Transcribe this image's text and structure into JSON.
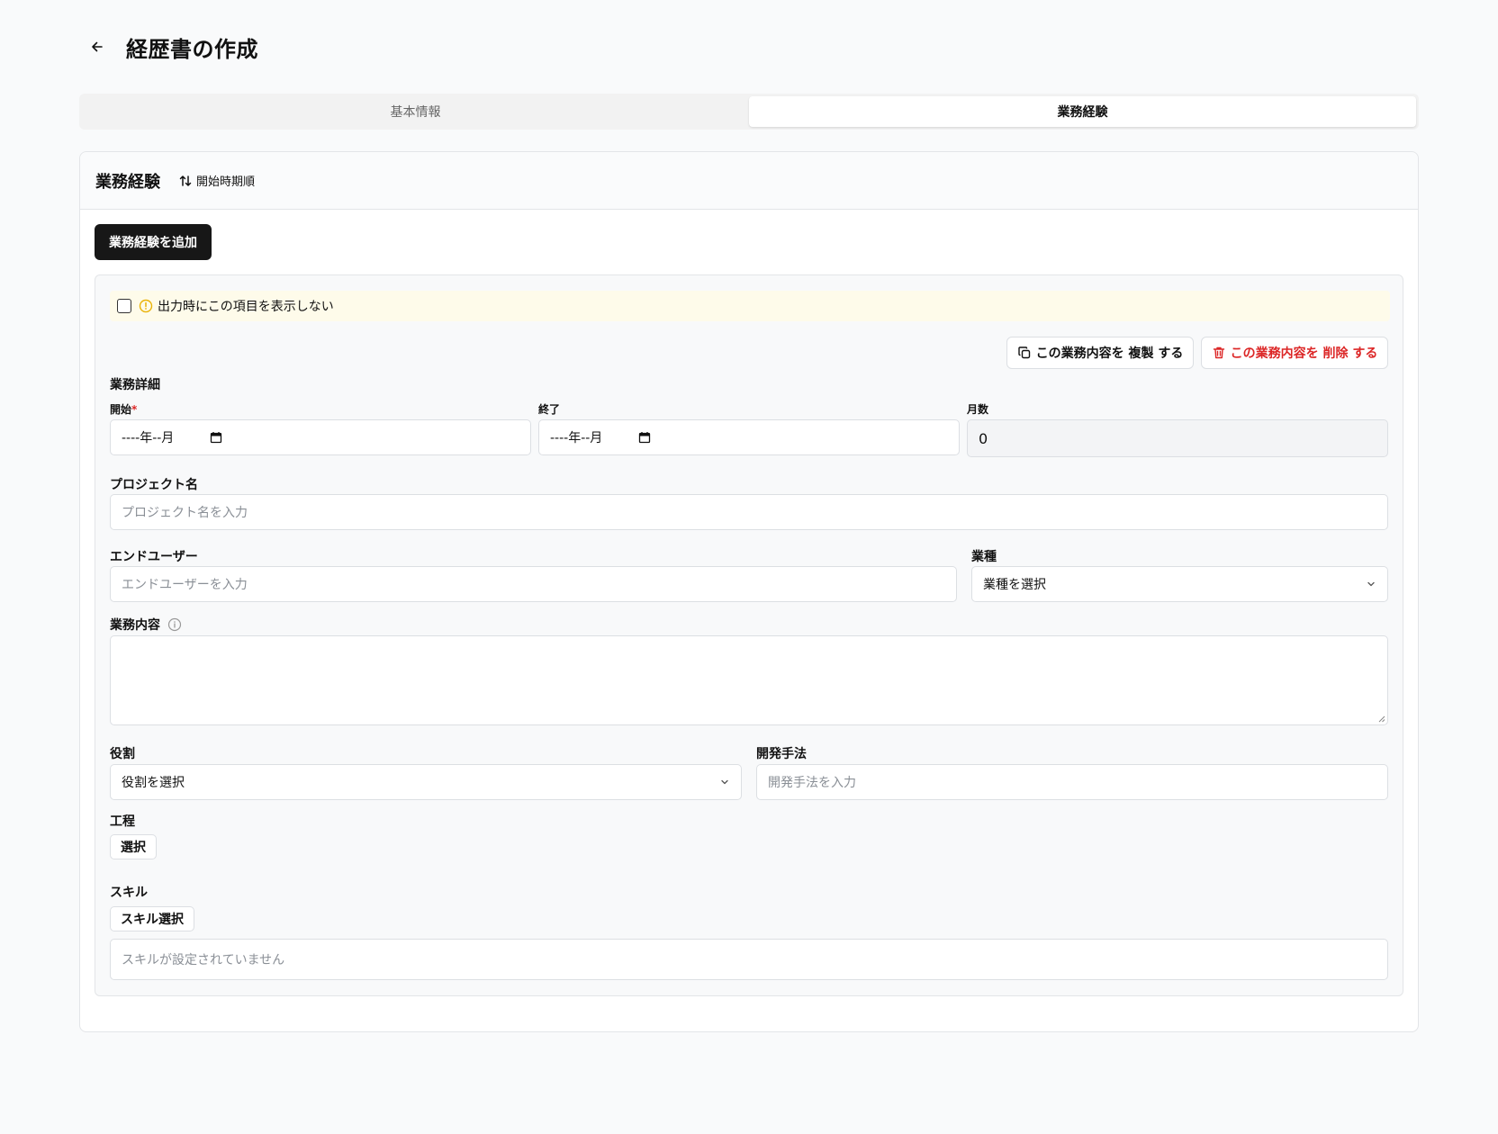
{
  "header": {
    "title": "経歴書の作成"
  },
  "tabs": [
    {
      "label": "基本情報",
      "active": false
    },
    {
      "label": "業務経験",
      "active": true
    }
  ],
  "section": {
    "title": "業務経験",
    "sort_label": "開始時期順",
    "add_button": "業務経験を追加"
  },
  "entry": {
    "hide_label": "出力時にこの項目を表示しない",
    "hide_checked": false,
    "copy_button": "この業務内容を 複製 する",
    "delete_button": "この業務内容を 削除 する",
    "details_title": "業務詳細",
    "start": {
      "label": "開始",
      "required_mark": "*",
      "value": "----年--月"
    },
    "end": {
      "label": "終了",
      "value": "----年--月"
    },
    "months": {
      "label": "月数",
      "value": "0"
    },
    "project": {
      "label": "プロジェクト名",
      "placeholder": "プロジェクト名を入力"
    },
    "end_user": {
      "label": "エンドユーザー",
      "placeholder": "エンドユーザーを入力"
    },
    "industry": {
      "label": "業種",
      "placeholder": "業種を選択"
    },
    "description": {
      "label": "業務内容"
    },
    "role": {
      "label": "役割",
      "placeholder": "役割を選択"
    },
    "method": {
      "label": "開発手法",
      "placeholder": "開発手法を入力"
    },
    "process": {
      "label": "工程",
      "button": "選択"
    },
    "skills": {
      "label": "スキル",
      "button": "スキル選択",
      "empty": "スキルが設定されていません"
    }
  },
  "colors": {
    "accent": "#171717",
    "danger": "#dc2626",
    "warning_bg": "#fefbea",
    "warning_icon": "#eab308"
  }
}
